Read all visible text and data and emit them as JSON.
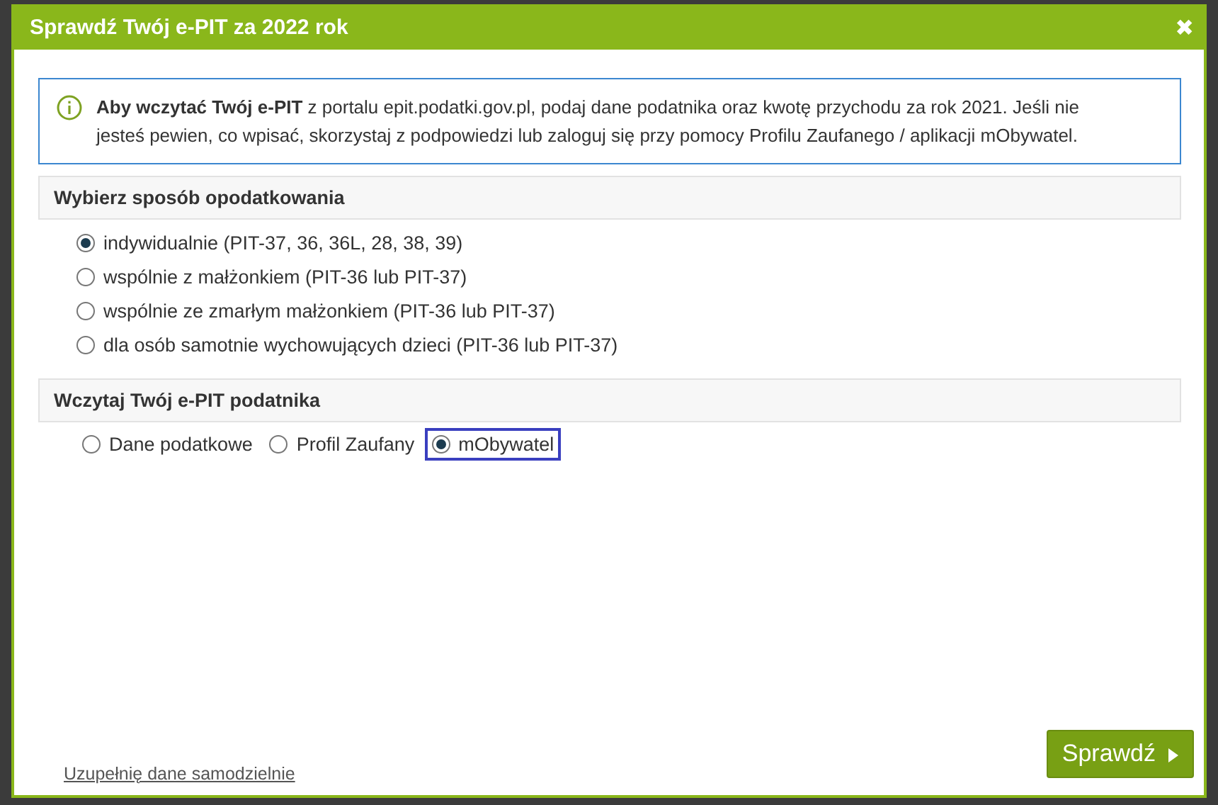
{
  "dialog": {
    "title": "Sprawdź Twój e-PIT za 2022 rok",
    "close": "✖"
  },
  "info": {
    "text": "**Aby wczytać Twój e-PIT** z portalu epit.podatki.gov.pl, podaj dane podatnika oraz kwotę przychodu za rok 2021. Jeśli nie jesteś pewien, co wpisać, skorzystaj z podpowiedzi lub zaloguj się przy pomocy Profilu Zaufanego / aplikacji mObywatel."
  },
  "sections": [
    {
      "title": "Wybierz sposób opodatkowania",
      "kind": "column",
      "options": [
        {
          "label": "indywidualnie (PIT-37, 36, 36L, 28, 38, 39)",
          "selected": true,
          "focused": false
        },
        {
          "label": "wspólnie z małżonkiem (PIT-36 lub PIT-37)",
          "selected": false,
          "focused": false
        },
        {
          "label": "wspólnie ze zmarłym małżonkiem (PIT-36 lub PIT-37)",
          "selected": false,
          "focused": false
        },
        {
          "label": "dla osób samotnie wychowujących dzieci (PIT-36 lub PIT-37)",
          "selected": false,
          "focused": false
        }
      ]
    },
    {
      "title": "Wczytaj Twój e-PIT podatnika",
      "kind": "row",
      "options": [
        {
          "label": "Dane podatkowe",
          "selected": false,
          "focused": false
        },
        {
          "label": "Profil Zaufany",
          "selected": false,
          "focused": false
        },
        {
          "label": "mObywatel",
          "selected": true,
          "focused": true
        }
      ]
    }
  ],
  "footer": {
    "link": "Uzupełnię dane samodzielnie",
    "button": "Sprawdź"
  }
}
